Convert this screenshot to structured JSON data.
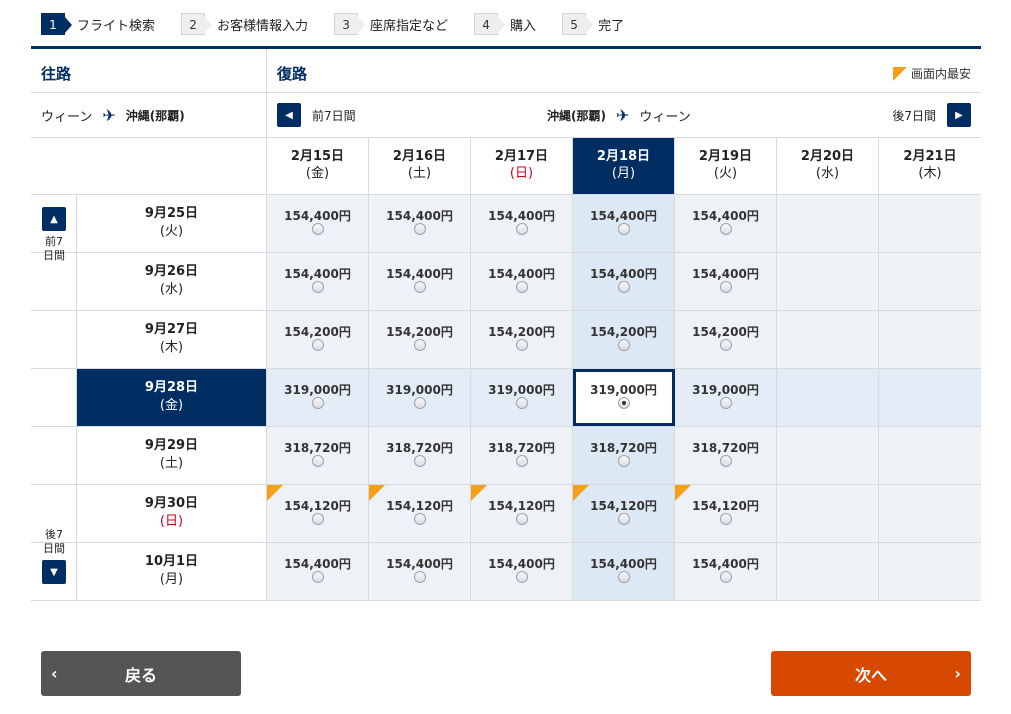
{
  "steps": [
    {
      "num": "1",
      "label": "フライト検索",
      "active": true
    },
    {
      "num": "2",
      "label": "お客様情報入力",
      "active": false
    },
    {
      "num": "3",
      "label": "座席指定など",
      "active": false
    },
    {
      "num": "4",
      "label": "購入",
      "active": false
    },
    {
      "num": "5",
      "label": "完了",
      "active": false
    }
  ],
  "outbound": {
    "heading": "往路",
    "from": "ウィーン",
    "to": "沖縄(那覇)"
  },
  "return": {
    "heading": "復路",
    "from": "沖縄(那覇)",
    "to": "ウィーン",
    "prev_label": "前7日間",
    "next_label": "後7日間"
  },
  "legend": {
    "label": "画面内最安",
    "color": "#f6a01a"
  },
  "side_nav": {
    "prev_label": "前7日間",
    "next_label": "後7日間"
  },
  "return_dates": [
    {
      "date": "2月15日",
      "dow": "(金)",
      "sunday": false,
      "selected": false
    },
    {
      "date": "2月16日",
      "dow": "(土)",
      "sunday": false,
      "selected": false
    },
    {
      "date": "2月17日",
      "dow": "(日)",
      "sunday": true,
      "selected": false
    },
    {
      "date": "2月18日",
      "dow": "(月)",
      "sunday": false,
      "selected": true
    },
    {
      "date": "2月19日",
      "dow": "(火)",
      "sunday": false,
      "selected": false
    },
    {
      "date": "2月20日",
      "dow": "(水)",
      "sunday": false,
      "selected": false
    },
    {
      "date": "2月21日",
      "dow": "(木)",
      "sunday": false,
      "selected": false
    }
  ],
  "rows": [
    {
      "date": "9月25日",
      "dow": "(火)",
      "sunday": false,
      "selected": false,
      "cheapest": false,
      "prices": [
        "154,400円",
        "154,400円",
        "154,400円",
        "154,400円",
        "154,400円",
        "",
        ""
      ]
    },
    {
      "date": "9月26日",
      "dow": "(水)",
      "sunday": false,
      "selected": false,
      "cheapest": false,
      "prices": [
        "154,400円",
        "154,400円",
        "154,400円",
        "154,400円",
        "154,400円",
        "",
        ""
      ]
    },
    {
      "date": "9月27日",
      "dow": "(木)",
      "sunday": false,
      "selected": false,
      "cheapest": false,
      "prices": [
        "154,200円",
        "154,200円",
        "154,200円",
        "154,200円",
        "154,200円",
        "",
        ""
      ]
    },
    {
      "date": "9月28日",
      "dow": "(金)",
      "sunday": false,
      "selected": true,
      "cheapest": false,
      "prices": [
        "319,000円",
        "319,000円",
        "319,000円",
        "319,000円",
        "319,000円",
        "",
        ""
      ]
    },
    {
      "date": "9月29日",
      "dow": "(土)",
      "sunday": false,
      "selected": false,
      "cheapest": false,
      "prices": [
        "318,720円",
        "318,720円",
        "318,720円",
        "318,720円",
        "318,720円",
        "",
        ""
      ]
    },
    {
      "date": "9月30日",
      "dow": "(日)",
      "sunday": true,
      "selected": false,
      "cheapest": true,
      "prices": [
        "154,120円",
        "154,120円",
        "154,120円",
        "154,120円",
        "154,120円",
        "",
        ""
      ]
    },
    {
      "date": "10月1日",
      "dow": "(月)",
      "sunday": false,
      "selected": false,
      "cheapest": false,
      "prices": [
        "154,400円",
        "154,400円",
        "154,400円",
        "154,400円",
        "154,400円",
        "",
        ""
      ]
    }
  ],
  "picked": {
    "row": 3,
    "col": 3
  },
  "buttons": {
    "back_label": "戻る",
    "next_label": "次へ"
  },
  "colors": {
    "brand": "#002d62",
    "next": "#d74800",
    "back": "#555555",
    "sunday": "#d0021b"
  }
}
